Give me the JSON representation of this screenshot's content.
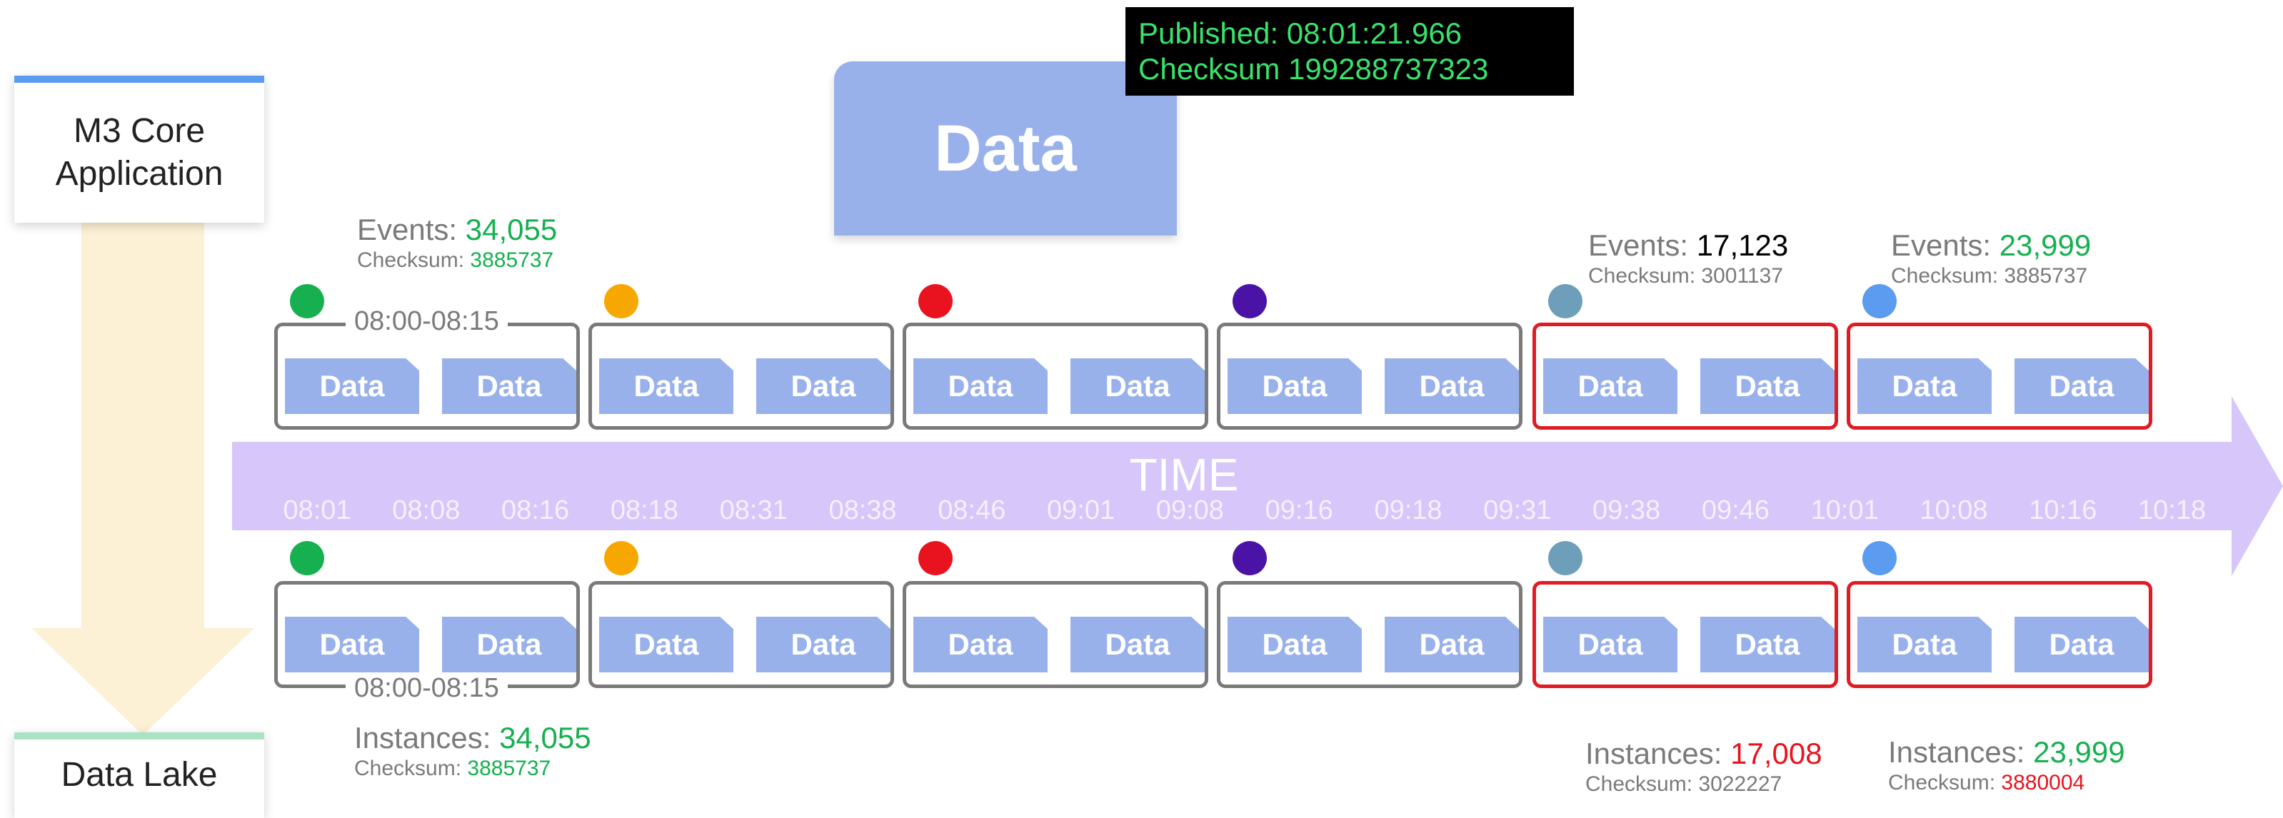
{
  "left_panel": {
    "source_box": {
      "line1": "M3 Core",
      "line2": "Application",
      "bar_color": "#5b9bf0"
    },
    "target_box": {
      "label": "Data Lake",
      "bar_color": "#a9e3c3"
    }
  },
  "published": {
    "line1": "Published: 08:01:21.966",
    "line2": "Checksum 199288737323",
    "text_color": "#39e36b"
  },
  "banner": {
    "label": "Data"
  },
  "timeline": {
    "label": "TIME",
    "ticks": [
      "08:01",
      "08:08",
      "08:16",
      "08:18",
      "08:31",
      "08:38",
      "08:46",
      "09:01",
      "09:08",
      "09:16",
      "09:18",
      "09:31",
      "09:38",
      "09:46",
      "10:01",
      "10:08",
      "10:16",
      "10:18"
    ],
    "color": "#d7c6fa"
  },
  "chip_label": "Data",
  "groups_top": [
    {
      "dot_color": "#16b050",
      "status": "normal"
    },
    {
      "dot_color": "#f7a800",
      "status": "normal"
    },
    {
      "dot_color": "#e8131e",
      "status": "normal"
    },
    {
      "dot_color": "#4a13a6",
      "status": "normal"
    },
    {
      "dot_color": "#6d9fba",
      "status": "alert"
    },
    {
      "dot_color": "#5b9bf0",
      "status": "alert"
    }
  ],
  "groups_bottom": [
    {
      "dot_color": "#16b050",
      "status": "normal"
    },
    {
      "dot_color": "#f7a800",
      "status": "normal"
    },
    {
      "dot_color": "#e8131e",
      "status": "normal"
    },
    {
      "dot_color": "#4a13a6",
      "status": "normal"
    },
    {
      "dot_color": "#6d9fba",
      "status": "alert"
    },
    {
      "dot_color": "#5b9bf0",
      "status": "alert"
    }
  ],
  "range_label_top": "08:00-08:15",
  "range_label_bottom": "08:00-08:15",
  "events": [
    {
      "label": "Events: ",
      "value": "34,055",
      "value_color": "#16b050",
      "checksum_label": "Checksum: ",
      "checksum": "3885737",
      "checksum_color": "#16b050"
    },
    {
      "label": "Events: ",
      "value": "17,123",
      "value_color": "#000000",
      "checksum_label": "Checksum: ",
      "checksum": "3001137",
      "checksum_color": "#7a7a7a"
    },
    {
      "label": "Events: ",
      "value": "23,999",
      "value_color": "#16b050",
      "checksum_label": "Checksum: ",
      "checksum": "3885737",
      "checksum_color": "#7a7a7a"
    }
  ],
  "instances": [
    {
      "label": "Instances: ",
      "value": "34,055",
      "value_color": "#16b050",
      "checksum_label": "Checksum: ",
      "checksum": "3885737",
      "checksum_color": "#16b050"
    },
    {
      "label": "Instances: ",
      "value": "17,008",
      "value_color": "#e8131e",
      "checksum_label": "Checksum: ",
      "checksum": "3022227",
      "checksum_color": "#7a7a7a"
    },
    {
      "label": "Instances: ",
      "value": "23,999",
      "value_color": "#16b050",
      "checksum_label": "Checksum: ",
      "checksum": "3880004",
      "checksum_color": "#e8131e"
    }
  ]
}
